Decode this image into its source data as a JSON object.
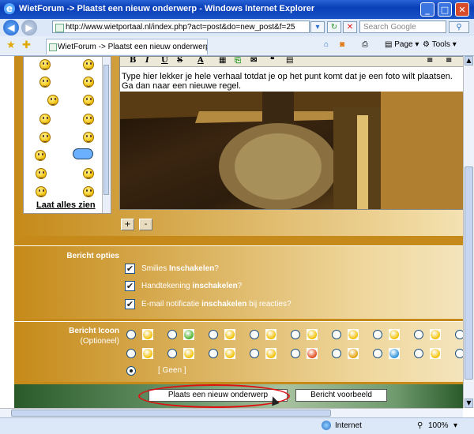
{
  "window": {
    "title": "WietForum -> Plaatst een nieuw onderwerp - Windows Internet Explorer",
    "min": "_",
    "max": "□",
    "close": "✕"
  },
  "address": {
    "url": "http://www.wietportaal.nl/index.php?act=post&do=new_post&f=25",
    "search_placeholder": "Search Google"
  },
  "tab": {
    "title": "WietForum -> Plaatst een nieuw onderwerp"
  },
  "toolbar": {
    "page_label": "Page",
    "tools_label": "Tools"
  },
  "smilies": {
    "view_all": "Laat alles zien"
  },
  "editor": {
    "tools": [
      "B",
      "I",
      "U",
      "S",
      "A"
    ],
    "text_line1": "Type hier lekker je hele verhaal totdat je op het punt komt dat je een foto wilt plaatsen.",
    "text_line2": "Ga dan naar een nieuwe regel.",
    "plus": "+",
    "minus": "-"
  },
  "options": {
    "label": "Bericht opties",
    "items": [
      {
        "pre": "Smilies ",
        "bold": "Inschakelen",
        "post": "?",
        "checked": "✔"
      },
      {
        "pre": "Handtekening ",
        "bold": "inschakelen",
        "post": "?",
        "checked": "✔"
      },
      {
        "pre": "E-mail notificatie ",
        "bold": "inschakelen",
        "post": " bij reacties?",
        "checked": "✔"
      }
    ]
  },
  "icon_section": {
    "label_line1": "Bericht Icoon",
    "label_line2": "(Optioneel)",
    "none_label": "[ Geen ]",
    "icons": [
      "smile-icon",
      "happy-icon",
      "wink-icon",
      "cool-icon",
      "laugh-icon",
      "shocked-icon",
      "grin-icon",
      "sad-icon",
      "tongue-icon",
      "angry-icon",
      "arrow-icon",
      "shades-icon",
      "question-icon",
      "exclaim-icon",
      "heart-icon",
      "info-icon",
      "ok-icon",
      "idea-icon",
      "blank-icon",
      "blank-icon2"
    ]
  },
  "buttons": {
    "submit": "Plaats een nieuw onderwerp",
    "preview": "Bericht voorbeeld"
  },
  "status": {
    "zone": "Internet",
    "zoom": "100%"
  }
}
